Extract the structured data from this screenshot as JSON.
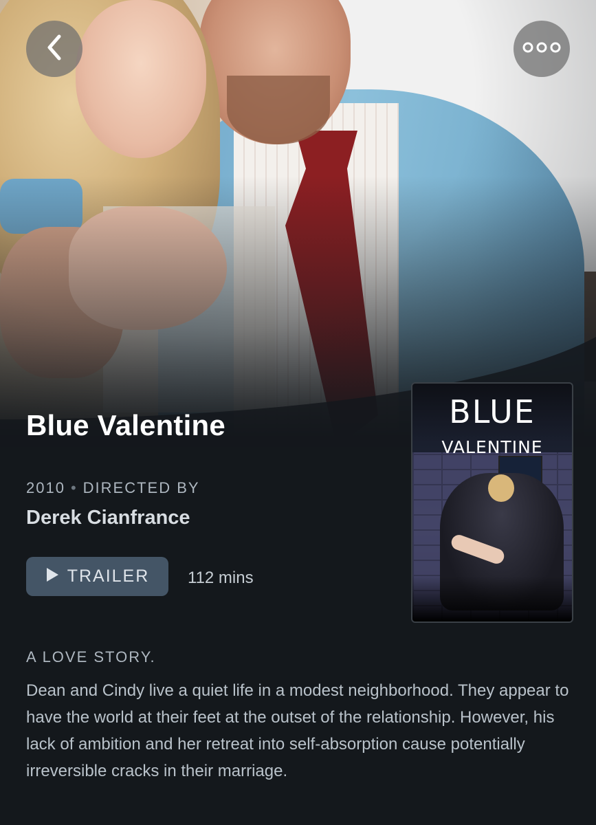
{
  "film": {
    "title": "Blue Valentine",
    "year": "2010",
    "directed_by_label": "DIRECTED BY",
    "director": "Derek Cianfrance",
    "runtime": "112 mins",
    "tagline": "A LOVE STORY.",
    "synopsis": "Dean and Cindy live a quiet life in a modest neighborhood. They appear to have the world at their feet at the outset of the relationship. However, his lack of ambition and her retreat into self-absorption cause potentially irreversible cracks in their marriage."
  },
  "actions": {
    "trailer_label": "TRAILER"
  },
  "poster": {
    "line1": "BLUE",
    "line2": "VALENTINE"
  },
  "icons": {
    "back": "chevron-left-icon",
    "more": "ellipsis-icon",
    "play": "play-icon"
  },
  "colors": {
    "background": "#14181c",
    "button": "#445566",
    "secondary_text": "#aeb7c0"
  }
}
